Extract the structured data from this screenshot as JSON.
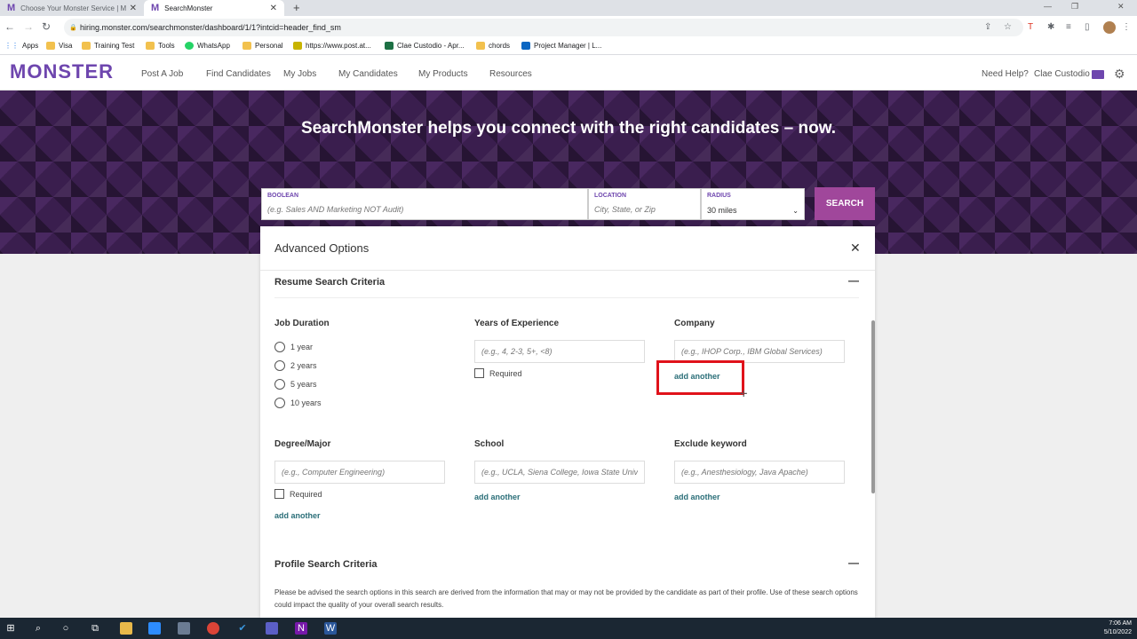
{
  "browser": {
    "tabs": [
      {
        "title": "Choose Your Monster Service | M"
      },
      {
        "title": "SearchMonster"
      }
    ],
    "url": "hiring.monster.com/searchmonster/dashboard/1/1?intcid=header_find_sm",
    "bookmarks": [
      "Apps",
      "Visa",
      "Training Test",
      "Tools",
      "WhatsApp",
      "Personal",
      "https://www.post.at...",
      "Clae Custodio - Apr...",
      "chords",
      "Project Manager | L..."
    ]
  },
  "header": {
    "logo": "MONSTER",
    "nav": [
      "Post A Job",
      "Find Candidates",
      "My Jobs",
      "My Candidates",
      "My Products",
      "Resources"
    ],
    "help": "Need Help?",
    "user": "Clae Custodio"
  },
  "hero": {
    "title": "SearchMonster helps you connect with the right candidates – now.",
    "boolean_label": "BOOLEAN",
    "boolean_placeholder": "(e.g. Sales AND Marketing NOT Audit)",
    "location_label": "LOCATION",
    "location_placeholder": "City, State, or Zip",
    "radius_label": "RADIUS",
    "radius_value": "30 miles",
    "search_button": "SEARCH"
  },
  "modal": {
    "title": "Advanced Options",
    "resume_section": "Resume Search Criteria",
    "job_duration": {
      "label": "Job Duration",
      "options": [
        "1 year",
        "2 years",
        "5 years",
        "10 years"
      ]
    },
    "years_experience": {
      "label": "Years of Experience",
      "placeholder": "(e.g., 4, 2-3, 5+, <8)",
      "required": "Required"
    },
    "company": {
      "label": "Company",
      "placeholder": "(e.g., IHOP Corp., IBM Global Services)",
      "add_another": "add another"
    },
    "degree": {
      "label": "Degree/Major",
      "placeholder": "(e.g., Computer Engineering)",
      "required": "Required",
      "add_another": "add another"
    },
    "school": {
      "label": "School",
      "placeholder": "(e.g., UCLA, Siena College, Iowa State Univ",
      "add_another": "add another"
    },
    "exclude": {
      "label": "Exclude keyword",
      "placeholder": "(e.g., Anesthesiology, Java Apache)",
      "add_another": "add another"
    },
    "profile_section": "Profile Search Criteria",
    "profile_note": "Please be advised the search options in this search are derived from the information that may or may not be provided by the candidate as part of their profile. Use of these search options could impact the quality of your overall search results."
  },
  "taskbar": {
    "time": "7:06 AM",
    "date": "5/10/2022"
  },
  "colors": {
    "brand": "#6e46ae",
    "search_button": "#a0479b",
    "link": "#2a6e78",
    "highlight": "#e0121b"
  }
}
